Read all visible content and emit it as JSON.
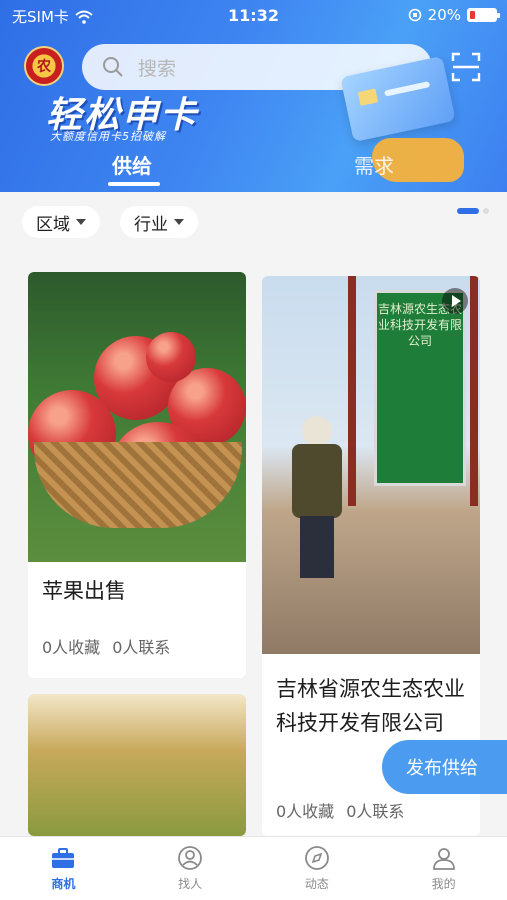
{
  "status_bar": {
    "carrier": "无SIM卡",
    "time": "11:32",
    "battery": "20%"
  },
  "header": {
    "logo_text": "农",
    "search_placeholder": "搜索",
    "banner_title": "轻松申卡",
    "banner_subtitle": "大额度信用卡5招破解"
  },
  "tabs": [
    {
      "label": "供给"
    },
    {
      "label": "需求"
    }
  ],
  "filters": [
    {
      "label": "区域"
    },
    {
      "label": "行业"
    }
  ],
  "cards": [
    {
      "title": "苹果出售",
      "favorites": "0人收藏",
      "contacts": "0人联系"
    },
    {
      "title": "吉林省源农生态农业科技开发有限公司",
      "favorites": "0人收藏",
      "contacts": "0人联系",
      "sign_text": "吉林源农生态农业科技开发有限公司"
    }
  ],
  "publish_button": "发布供给",
  "bottom_nav": [
    {
      "label": "商机",
      "icon": "briefcase-icon"
    },
    {
      "label": "找人",
      "icon": "person-search-icon"
    },
    {
      "label": "动态",
      "icon": "compass-icon"
    },
    {
      "label": "我的",
      "icon": "user-icon"
    }
  ],
  "colors": {
    "primary": "#2f6fe6",
    "publish": "#4b9cf0"
  }
}
